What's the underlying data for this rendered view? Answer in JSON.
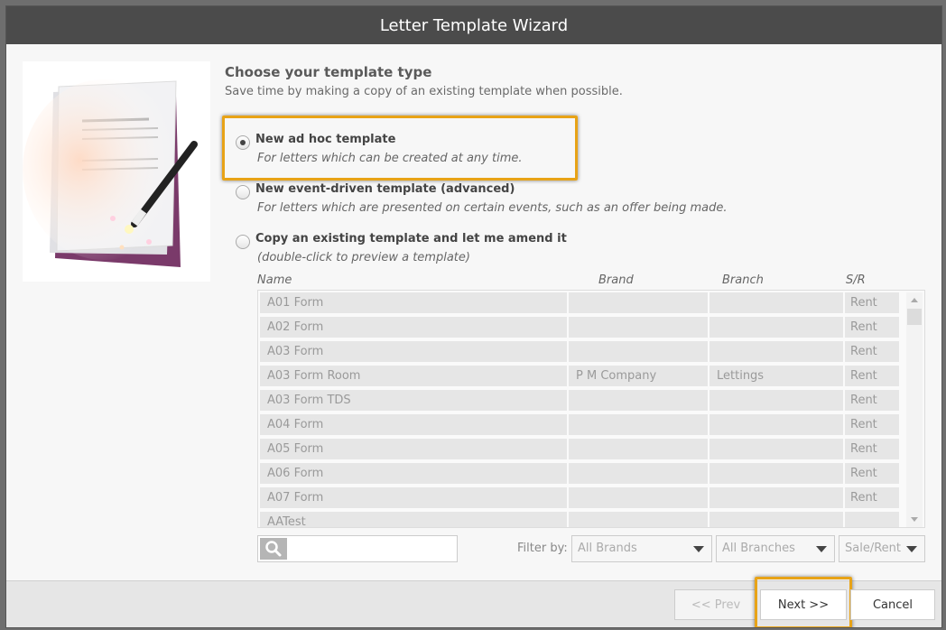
{
  "window": {
    "title": "Letter Template Wizard"
  },
  "header": {
    "title": "Choose your template type",
    "subtitle": "Save time by making a copy of an existing template when possible."
  },
  "options": [
    {
      "label": "New ad hoc template",
      "description": "For letters which can be created at any time.",
      "selected": true
    },
    {
      "label": "New event-driven template (advanced)",
      "description": "For letters which are presented on certain events, such as an offer being made.",
      "selected": false
    },
    {
      "label": "Copy an existing template and let me amend it",
      "description": "(double-click to preview a template)",
      "selected": false
    }
  ],
  "table": {
    "columns": [
      "Name",
      "Brand",
      "Branch",
      "S/R"
    ],
    "rows": [
      [
        "A01 Form",
        "",
        "",
        "Rent"
      ],
      [
        "A02 Form",
        "",
        "",
        "Rent"
      ],
      [
        "A03 Form",
        "",
        "",
        "Rent"
      ],
      [
        "A03 Form Room",
        "P M Company",
        "Lettings",
        "Rent"
      ],
      [
        "A03 Form TDS",
        "",
        "",
        "Rent"
      ],
      [
        "A04 Form",
        "",
        "",
        "Rent"
      ],
      [
        "A05 Form",
        "",
        "",
        "Rent"
      ],
      [
        "A06 Form",
        "",
        "",
        "Rent"
      ],
      [
        "A07 Form",
        "",
        "",
        "Rent"
      ],
      [
        "AATest",
        "",
        "",
        ""
      ]
    ]
  },
  "filter": {
    "label": "Filter by:",
    "search_value": "",
    "brands": "All Brands",
    "branches": "All Branches",
    "sale_rent": "Sale/Rent"
  },
  "buttons": {
    "prev": "<< Prev",
    "next": "Next >>",
    "cancel": "Cancel"
  },
  "colors": {
    "highlight": "#e8a317",
    "titlebar": "#4b4b4b"
  }
}
